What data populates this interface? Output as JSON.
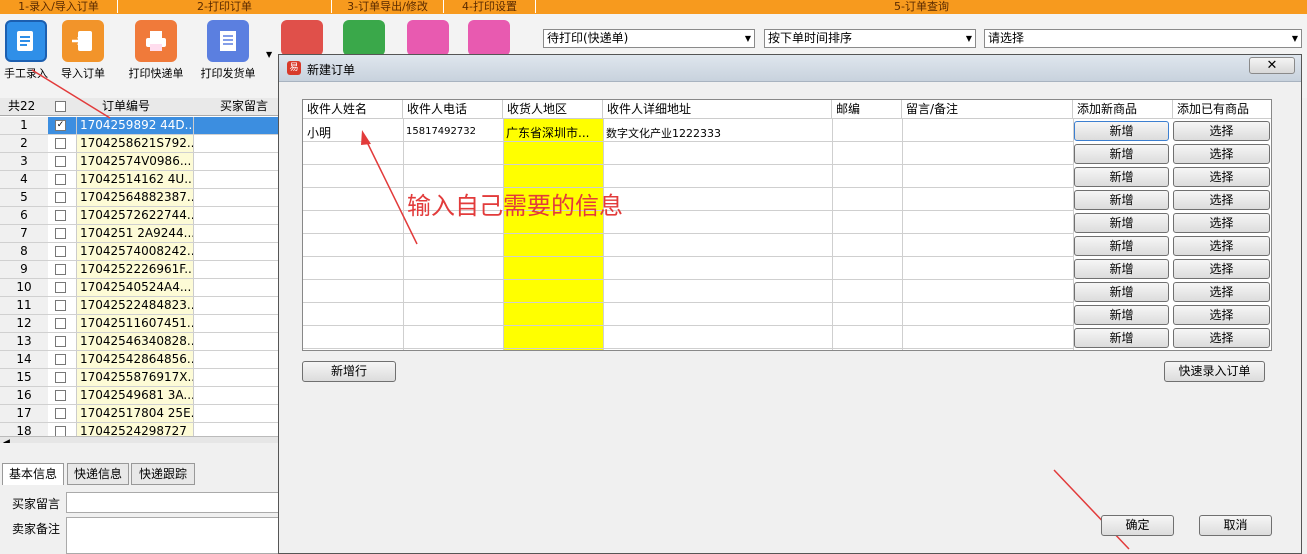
{
  "section_bar": [
    "1-录入/导入订单",
    "2-打印订单",
    "3-订单导出/修改",
    "4-打印设置",
    "5-订单查询"
  ],
  "toolbar": {
    "buttons": [
      {
        "label": "手工录入",
        "icon": "manual-entry-icon",
        "color": "#2f8fe8"
      },
      {
        "label": "导入订单",
        "icon": "import-order-icon",
        "color": "#f2942a"
      },
      {
        "label": "打印快递单",
        "icon": "printer-icon",
        "color": "#f07a3a"
      },
      {
        "label": "打印发货单",
        "icon": "invoice-icon",
        "color": "#5b7fe0"
      }
    ],
    "filters": [
      "待打印(快递单)",
      "按下单时间排序",
      "请选择"
    ]
  },
  "left_grid": {
    "count_label": "共22",
    "col_order": "订单编号",
    "col_buyer_msg": "买家留言",
    "rows": [
      {
        "n": "1",
        "id": "1704259892 44D...",
        "checked": true
      },
      {
        "n": "2",
        "id": "1704258621S792..."
      },
      {
        "n": "3",
        "id": "17042574V0986..."
      },
      {
        "n": "4",
        "id": "17042514162 4U..."
      },
      {
        "n": "5",
        "id": "17042564882387..."
      },
      {
        "n": "6",
        "id": "17042572622744..."
      },
      {
        "n": "7",
        "id": "1704251 2A9244..."
      },
      {
        "n": "8",
        "id": "17042574008242..."
      },
      {
        "n": "9",
        "id": "1704252226961F..."
      },
      {
        "n": "10",
        "id": "17042540524A4..."
      },
      {
        "n": "11",
        "id": "17042522484823..."
      },
      {
        "n": "12",
        "id": "17042511607451..."
      },
      {
        "n": "13",
        "id": "17042546340828..."
      },
      {
        "n": "14",
        "id": "17042542864856..."
      },
      {
        "n": "15",
        "id": "1704255876917X..."
      },
      {
        "n": "16",
        "id": "17042549681 3A..."
      },
      {
        "n": "17",
        "id": "17042517804 25E..."
      },
      {
        "n": "18",
        "id": "17042524298727"
      }
    ]
  },
  "bottom_panel": {
    "tabs": [
      "基本信息",
      "快递信息",
      "快递跟踪"
    ],
    "buyer_msg_label": "买家留言",
    "buyer_note_label": "卖家备注"
  },
  "dialog": {
    "title": "新建订单",
    "columns": [
      "收件人姓名",
      "收件人电话",
      "收货人地区",
      "收件人详细地址",
      "邮编",
      "留言/备注",
      "添加新商品",
      "添加已有商品"
    ],
    "row1": {
      "name": "小明",
      "phone": "15817492732",
      "region": "广东省深圳市...",
      "address": "数字文化产业1222333"
    },
    "add_new_label": "新增",
    "choose_label": "选择",
    "annotation": "输入自己需要的信息",
    "add_row_label": "新增行",
    "quick_entry_label": "快速录入订单",
    "ok_label": "确定",
    "cancel_label": "取消",
    "highlight_color": "#ffff00",
    "annotation_color": "#e23b3b"
  }
}
